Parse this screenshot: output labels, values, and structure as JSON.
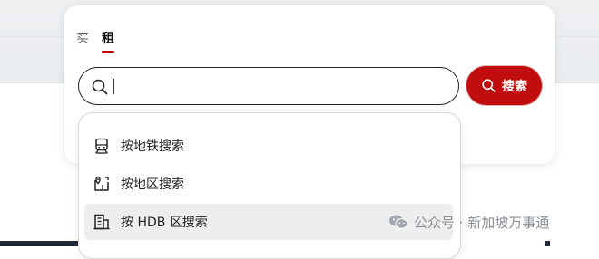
{
  "tabs": {
    "buy_label": "买",
    "rent_label": "租",
    "active": "rent"
  },
  "search": {
    "value": "",
    "placeholder": "",
    "button_label": "搜索",
    "button_color": "#c00d0d"
  },
  "dropdown": {
    "options": [
      {
        "label": "按地铁搜索",
        "icon": "train-icon"
      },
      {
        "label": "按地区搜索",
        "icon": "map-pin-icon"
      },
      {
        "label": "按 HDB 区搜索",
        "icon": "building-icon"
      }
    ],
    "highlighted_index": 2
  },
  "watermark": {
    "text": "公众号 · 新加坡万事通",
    "icon": "wechat-icon"
  }
}
